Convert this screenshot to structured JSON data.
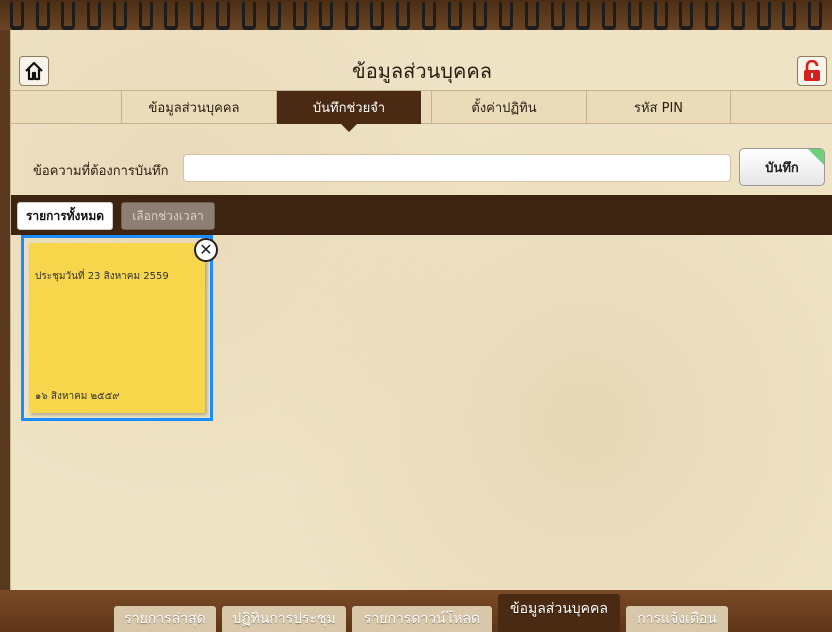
{
  "header": {
    "title": "ข้อมูลส่วนบุคคล",
    "home_icon": "home-icon",
    "lock_icon": "unlock-icon"
  },
  "tabs": [
    {
      "label": "ข้อมูลส่วนบุคคล",
      "active": false
    },
    {
      "label": "บันทึกช่วยจำ",
      "active": true
    },
    {
      "label": "ตั้งค่าปฏิทิน",
      "active": false
    },
    {
      "label": "รหัส PIN",
      "active": false
    }
  ],
  "memo": {
    "label": "ข้อความที่ต้องการบันทึก",
    "value": "",
    "save_label": "บันทึก"
  },
  "filters": {
    "all_label": "รายการทั้งหมด",
    "range_label": "เลือกช่วงเวลา"
  },
  "notes": [
    {
      "text": "ประชุมวันที่ 23 สิงหาคม 2559",
      "date": "๑๖ สิงหาคม ๒๕๕๙"
    }
  ],
  "bottom_tabs": [
    {
      "label": "รายการล่าสุด",
      "active": false
    },
    {
      "label": "ปฏิทินการประชุม",
      "active": false
    },
    {
      "label": "รายการดาวน์โหลด",
      "active": false
    },
    {
      "label": "ข้อมูลส่วนบุคคล",
      "active": true
    },
    {
      "label": "การแจ้งเตือน",
      "active": false
    }
  ],
  "colors": {
    "accent_dark": "#4a2a12",
    "note_yellow": "#f7d64c",
    "selection_blue": "#1a8cff"
  }
}
